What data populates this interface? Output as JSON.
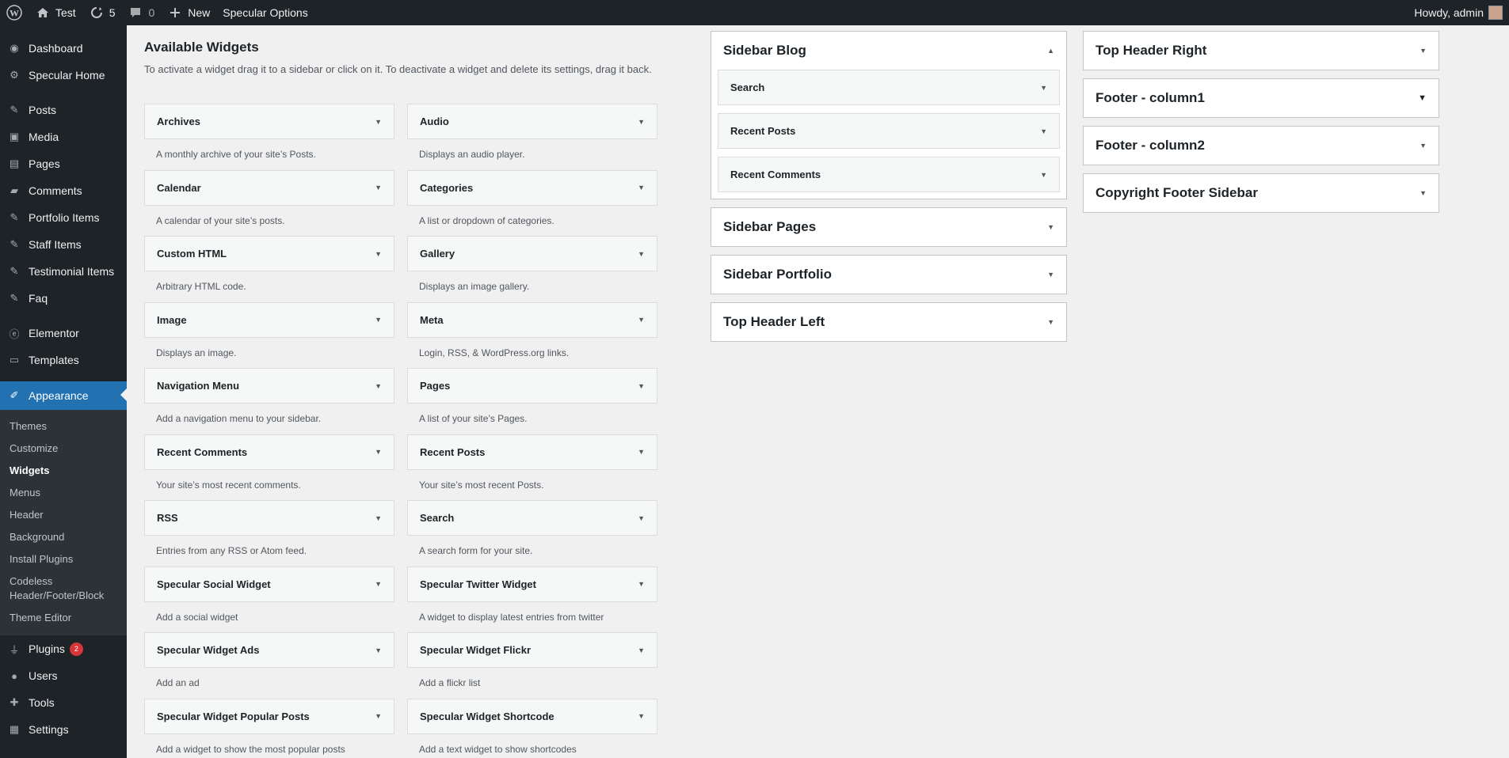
{
  "adminbar": {
    "site_name": "Test",
    "updates_count": "5",
    "comments_count": "0",
    "new_label": "New",
    "theme_options_label": "Specular Options",
    "howdy": "Howdy, admin"
  },
  "menu": {
    "dashboard": "Dashboard",
    "specular_home": "Specular Home",
    "posts": "Posts",
    "media": "Media",
    "pages": "Pages",
    "comments": "Comments",
    "portfolio_items": "Portfolio Items",
    "staff_items": "Staff Items",
    "testimonial_items": "Testimonial Items",
    "faq": "Faq",
    "elementor": "Elementor",
    "templates": "Templates",
    "appearance": "Appearance",
    "appearance_sub": [
      "Themes",
      "Customize",
      "Widgets",
      "Menus",
      "Header",
      "Background",
      "Install Plugins",
      "Codeless Header/Footer/Block",
      "Theme Editor"
    ],
    "plugins": "Plugins",
    "plugins_badge": "2",
    "users": "Users",
    "tools": "Tools",
    "settings": "Settings"
  },
  "available": {
    "title": "Available Widgets",
    "description": "To activate a widget drag it to a sidebar or click on it. To deactivate a widget and delete its settings, drag it back.",
    "widgets": [
      {
        "name": "Archives",
        "desc": "A monthly archive of your site’s Posts."
      },
      {
        "name": "Audio",
        "desc": "Displays an audio player."
      },
      {
        "name": "Calendar",
        "desc": "A calendar of your site’s posts."
      },
      {
        "name": "Categories",
        "desc": "A list or dropdown of categories."
      },
      {
        "name": "Custom HTML",
        "desc": "Arbitrary HTML code."
      },
      {
        "name": "Gallery",
        "desc": "Displays an image gallery."
      },
      {
        "name": "Image",
        "desc": "Displays an image."
      },
      {
        "name": "Meta",
        "desc": "Login, RSS, & WordPress.org links."
      },
      {
        "name": "Navigation Menu",
        "desc": "Add a navigation menu to your sidebar."
      },
      {
        "name": "Pages",
        "desc": "A list of your site’s Pages."
      },
      {
        "name": "Recent Comments",
        "desc": "Your site’s most recent comments."
      },
      {
        "name": "Recent Posts",
        "desc": "Your site’s most recent Posts."
      },
      {
        "name": "RSS",
        "desc": "Entries from any RSS or Atom feed."
      },
      {
        "name": "Search",
        "desc": "A search form for your site."
      },
      {
        "name": "Specular Social Widget",
        "desc": "Add a social widget"
      },
      {
        "name": "Specular Twitter Widget",
        "desc": "A widget to display latest entries from twitter"
      },
      {
        "name": "Specular Widget Ads",
        "desc": "Add an ad"
      },
      {
        "name": "Specular Widget Flickr",
        "desc": "Add a flickr list"
      },
      {
        "name": "Specular Widget Popular Posts",
        "desc": "Add a widget to show the most popular posts"
      },
      {
        "name": "Specular Widget Shortcode",
        "desc": "Add a text widget to show shortcodes"
      }
    ]
  },
  "sidebars_left": [
    {
      "title": "Sidebar Blog",
      "widgets": [
        "Search",
        "Recent Posts",
        "Recent Comments"
      ],
      "expanded": true
    },
    {
      "title": "Sidebar Pages"
    },
    {
      "title": "Sidebar Portfolio"
    },
    {
      "title": "Top Header Left"
    }
  ],
  "sidebars_right": [
    {
      "title": "Top Header Right"
    },
    {
      "title": "Footer - column1"
    },
    {
      "title": "Footer - column2"
    },
    {
      "title": "Copyright Footer Sidebar"
    }
  ],
  "icons": {
    "wp_logo": "wordpress-logo-icon",
    "home": "home-icon",
    "updates": "refresh-icon",
    "comments": "comment-bubble-icon",
    "new": "plus-icon",
    "expand": "caret-down-icon",
    "collapse": "caret-up-icon"
  },
  "colors": {
    "adminbar_bg": "#1d2327",
    "menu_current": "#2271b1",
    "badge": "#d63638"
  }
}
